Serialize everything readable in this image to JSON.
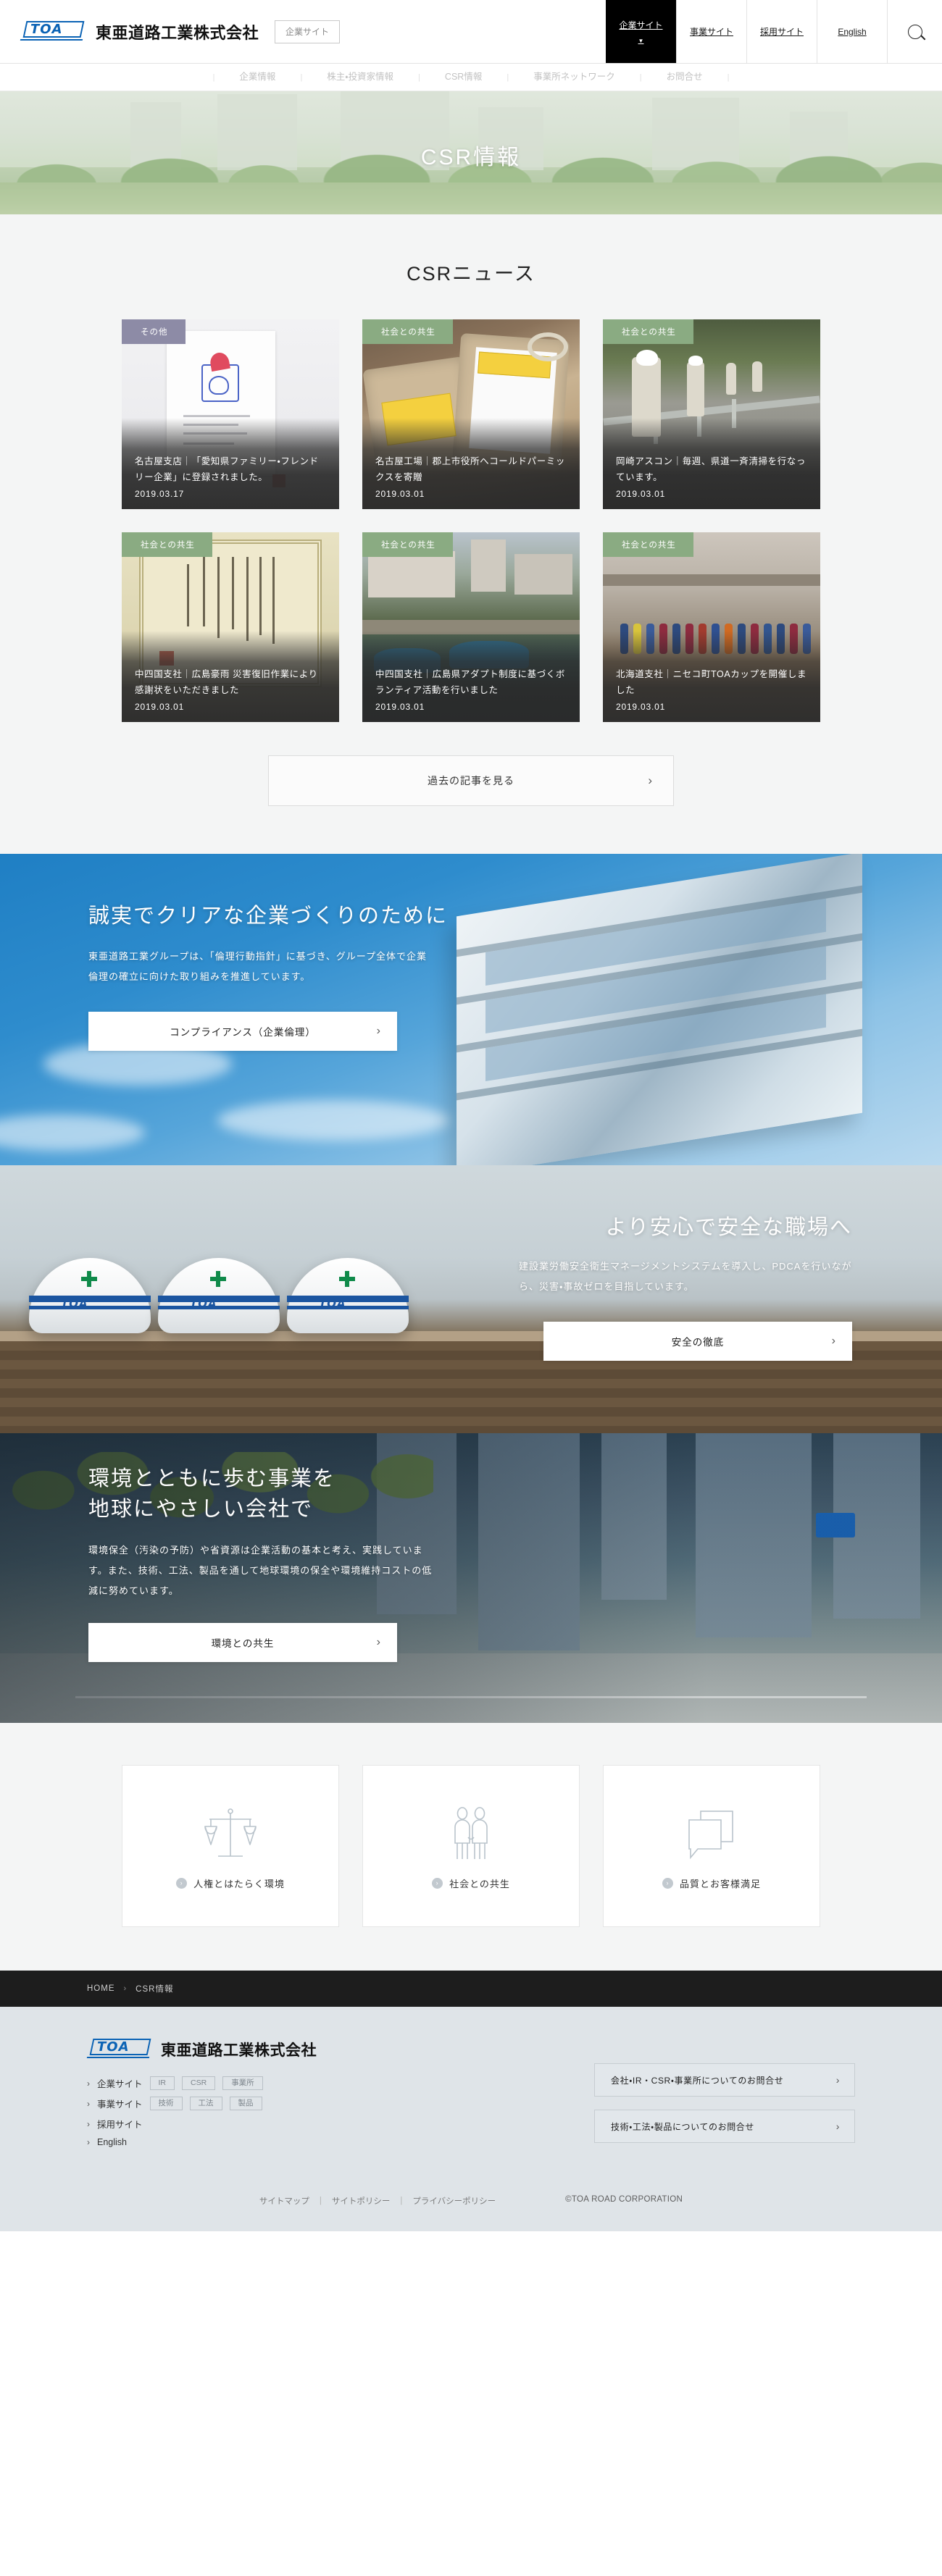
{
  "header": {
    "brand_name": "東亜道路工業株式会社",
    "logo_text": "TOA",
    "site_badge": "企業サイト",
    "nav": [
      {
        "label": "企業サイト",
        "active": true,
        "caret": "▼"
      },
      {
        "label": "事業サイト",
        "active": false
      },
      {
        "label": "採用サイト",
        "active": false
      },
      {
        "label": "English",
        "active": false
      }
    ],
    "search_icon": "search-icon"
  },
  "subnav": {
    "items": [
      "企業情報",
      "株主・投資家情報",
      "CSR情報",
      "事業所ネットワーク",
      "お問合せ"
    ]
  },
  "hero": {
    "title": "CSR情報"
  },
  "news": {
    "title": "CSRニュース",
    "more_label": "過去の記事を見る",
    "more_chevron": "›",
    "cards": [
      {
        "tag": "その他",
        "tag_kind": "other",
        "headline": "名古屋支店｜「愛知県ファミリー・フレンドリー企業」に登録されました。",
        "date": "2019.03.17"
      },
      {
        "tag": "社会との共生",
        "tag_kind": "society",
        "headline": "名古屋工場｜郡上市役所へコールドパーミックスを寄贈",
        "date": "2019.03.01"
      },
      {
        "tag": "社会との共生",
        "tag_kind": "society",
        "headline": "岡崎アスコン｜毎週、県道一斉清掃を行なっています。",
        "date": "2019.03.01"
      },
      {
        "tag": "社会との共生",
        "tag_kind": "society",
        "headline": "中四国支社｜広島豪雨 災害復旧作業により感謝状をいただきました",
        "date": "2019.03.01"
      },
      {
        "tag": "社会との共生",
        "tag_kind": "society",
        "headline": "中四国支社｜広島県アダプト制度に基づくボランティア活動を行いました",
        "date": "2019.03.01"
      },
      {
        "tag": "社会との共生",
        "tag_kind": "society",
        "headline": "北海道支社｜ニセコ町TOAカップを開催しました",
        "date": "2019.03.01"
      }
    ]
  },
  "banners": {
    "compliance": {
      "title": "誠実でクリアな企業づくりのために",
      "body": "東亜道路工業グループは、「倫理行動指針」に基づき、グループ全体で企業倫理の確立に向けた取り組みを推進しています。",
      "cta": "コンプライアンス（企業倫理）",
      "chevron": "›"
    },
    "safety": {
      "title": "より安心で安全な職場へ",
      "body": "建設業労働安全衛生マネージメントシステムを導入し、PDCAを行いながら、災害・事故ゼロを目指しています。",
      "cta": "安全の徹底",
      "chevron": "›",
      "helmet_text": "TOA"
    },
    "environment": {
      "title_line1": "環境とともに歩む事業を",
      "title_line2": "地球にやさしい会社で",
      "body": "環境保全（汚染の予防）や省資源は企業活動の基本と考え、実践しています。また、技術、工法、製品を通して地球環境の保全や環境維持コストの低減に努めています。",
      "cta": "環境との共生",
      "chevron": "›"
    }
  },
  "cards": [
    {
      "label": "人権とはたらく環境",
      "icon": "scales-icon",
      "bullet": "›"
    },
    {
      "label": "社会との共生",
      "icon": "two-people-icon",
      "bullet": "›"
    },
    {
      "label": "品質とお客様満足",
      "icon": "speech-bubbles-icon",
      "bullet": "›"
    }
  ],
  "breadcrumb": {
    "home": "HOME",
    "separator": "›",
    "current": "CSR情報"
  },
  "footer": {
    "brand_name": "東亜道路工業株式会社",
    "logo_text": "TOA",
    "nav": [
      {
        "label": "企業サイト",
        "arrow": "›",
        "pills": [
          "IR",
          "CSR",
          "事業所"
        ]
      },
      {
        "label": "事業サイト",
        "arrow": "›",
        "pills": [
          "技術",
          "工法",
          "製品"
        ]
      },
      {
        "label": "採用サイト",
        "arrow": "›",
        "pills": []
      },
      {
        "label": "English",
        "arrow": "›",
        "pills": []
      }
    ],
    "contacts": [
      {
        "label": "会社・IR・CSR・事業所についてのお問合せ",
        "chevron": "›"
      },
      {
        "label": "技術・工法・製品についてのお問合せ",
        "chevron": "›"
      }
    ],
    "links": [
      "サイトマップ",
      "サイトポリシー",
      "プライバシーポリシー"
    ],
    "link_separator": "|",
    "copyright": "©TOA ROAD CORPORATION"
  },
  "colors": {
    "accent_blue": "#0b63b5",
    "tag_other": "#8d8ba6",
    "tag_society": "#8aab82",
    "news_bg": "#f4f5f5",
    "footer_bg": "#dfe4e8",
    "crumb_bg": "#1d1d1d"
  }
}
